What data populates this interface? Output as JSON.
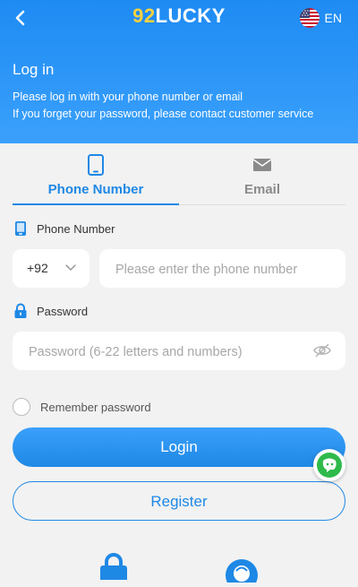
{
  "header": {
    "logo_part1": "92",
    "logo_part2": "LUCKY",
    "language": "EN",
    "title": "Log in",
    "line1": "Please log in with your phone number or email",
    "line2": "If you forget your password, please contact customer service"
  },
  "tabs": [
    {
      "label": "Phone Number",
      "active": true
    },
    {
      "label": "Email",
      "active": false
    }
  ],
  "form": {
    "phone_label": "Phone Number",
    "country_code": "+92",
    "phone_placeholder": "Please enter the phone number",
    "password_label": "Password",
    "password_placeholder": "Password (6-22 letters and numbers)",
    "remember_label": "Remember password"
  },
  "buttons": {
    "login": "Login",
    "register": "Register"
  },
  "colors": {
    "accent": "#1e88e5",
    "header_top": "#1e8bf3",
    "logo_yellow": "#ffd23f",
    "background": "#f2f2f2",
    "chat_green": "#2fba4b"
  },
  "icons": [
    "chevron-left-icon",
    "us-flag-icon",
    "tablet-icon",
    "mail-icon",
    "lock-icon",
    "chevron-down-icon",
    "eye-off-icon",
    "chat-icon",
    "customer-service-icon"
  ]
}
